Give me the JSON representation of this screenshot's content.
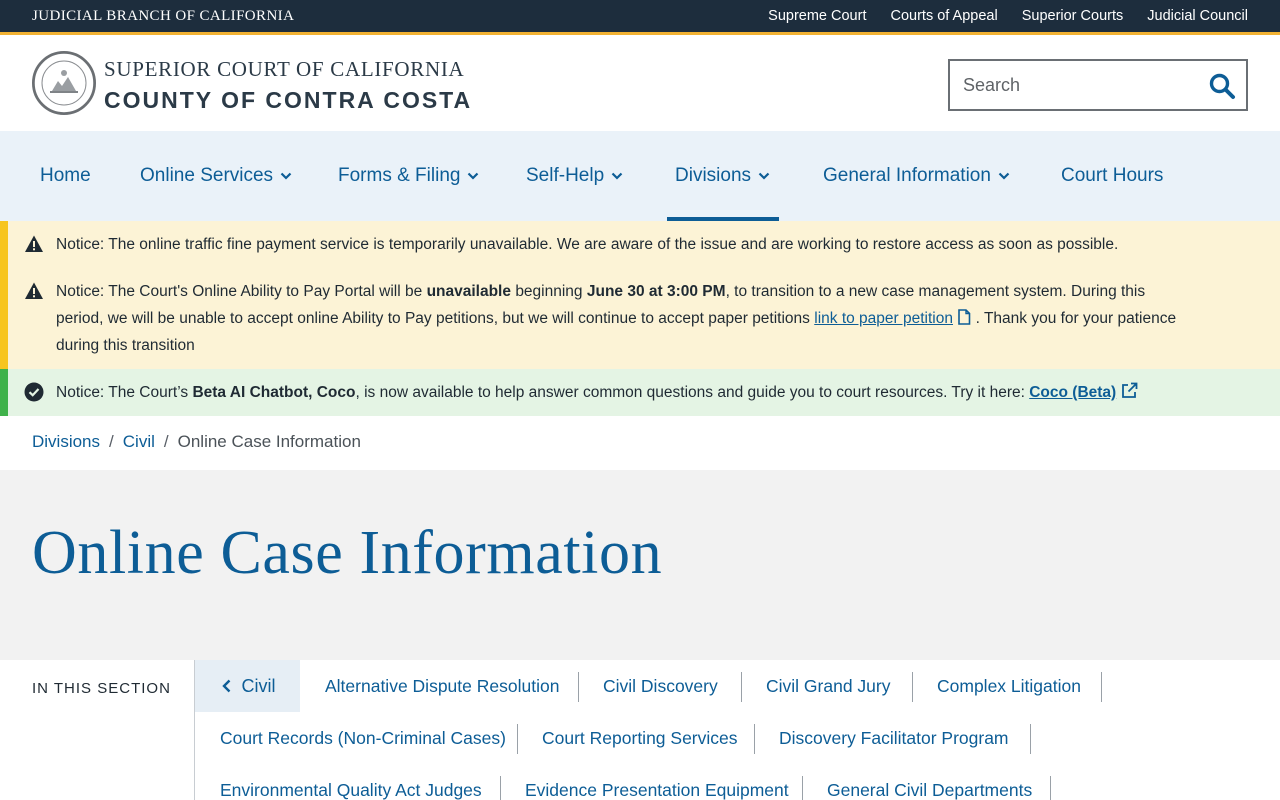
{
  "topbar": {
    "branch": "JUDICIAL BRANCH OF CALIFORNIA",
    "links": [
      "Supreme Court",
      "Courts of Appeal",
      "Superior Courts",
      "Judicial Council"
    ]
  },
  "header": {
    "title_line1": "SUPERIOR COURT OF CALIFORNIA",
    "title_line2": "COUNTY OF CONTRA COSTA",
    "search_placeholder": "Search"
  },
  "nav": {
    "items": [
      {
        "label": "Home"
      },
      {
        "label": "Online Services"
      },
      {
        "label": "Forms & Filing"
      },
      {
        "label": "Self-Help"
      },
      {
        "label": "Divisions"
      },
      {
        "label": "General Information"
      },
      {
        "label": "Court Hours"
      }
    ]
  },
  "notices": {
    "n1": {
      "prefix": "Notice:",
      "text": "The online traffic fine payment service is temporarily unavailable. We are aware of the issue and are working to restore access as soon as possible."
    },
    "n2": {
      "prefix": "Notice:",
      "part1": "The Court's Online Ability to Pay Portal will be",
      "bold1": "unavailable",
      "part2": "beginning",
      "bold2": "June 30 at 3:00 PM",
      "part3": ", to transition to a new case management system. During this period, we will be unable to accept online Ability to Pay petitions, but we will continue to accept paper petitions",
      "link": "link to paper petition",
      "part4": ". Thank you for your patience during this transition"
    },
    "n3": {
      "prefix": "Notice:",
      "part1": "The Court’s",
      "bold1": "Beta AI Chatbot, Coco",
      "part2": ", is now available to help answer common questions and guide you to court resources. Try it here:",
      "link": "Coco (Beta)"
    }
  },
  "breadcrumb": {
    "items": [
      "Divisions",
      "Civil"
    ],
    "current": "Online Case Information"
  },
  "page": {
    "title": "Online Case Information"
  },
  "section": {
    "label": "IN THIS SECTION",
    "back": "Civil",
    "links": [
      "Alternative Dispute Resolution",
      "Civil Discovery",
      "Civil Grand Jury",
      "Complex Litigation",
      "Court Records (Non-Criminal Cases)",
      "Court Reporting Services",
      "Discovery Facilitator Program",
      "Environmental Quality Act Judges",
      "Evidence Presentation Equipment",
      "General Civil Departments"
    ]
  },
  "colors": {
    "brand_blue": "#0d5d96",
    "topbar_bg": "#1d2d3d",
    "gold_accent": "#f2b233",
    "notice_yellow": "#fcf3d6",
    "notice_green": "#e4f4e4"
  }
}
